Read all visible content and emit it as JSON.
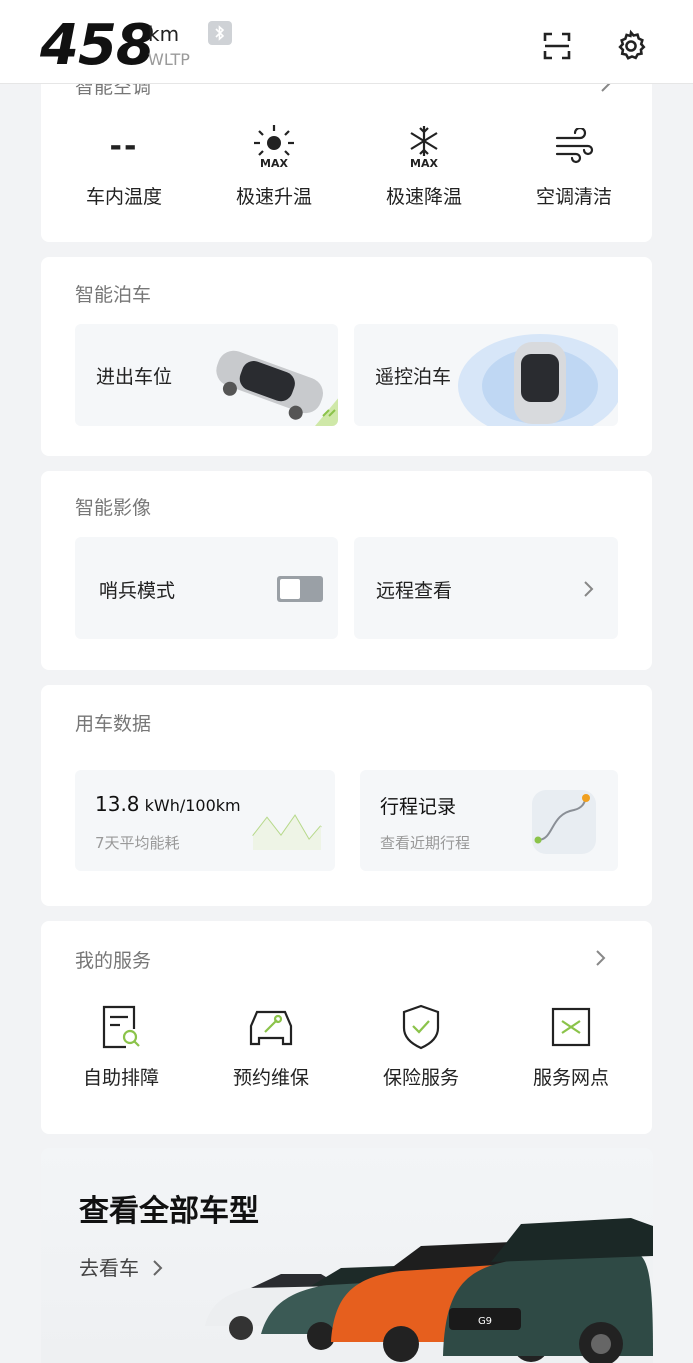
{
  "header": {
    "range_value": "458",
    "range_unit": "km",
    "range_standard": "WLTP"
  },
  "climate": {
    "title": "智能空调",
    "items": [
      {
        "label": "车内温度",
        "value": "--"
      },
      {
        "label": "极速升温",
        "badge": "MAX"
      },
      {
        "label": "极速降温",
        "badge": "MAX"
      },
      {
        "label": "空调清洁"
      }
    ]
  },
  "parking": {
    "title": "智能泊车",
    "items": [
      {
        "label": "进出车位"
      },
      {
        "label": "遥控泊车"
      }
    ]
  },
  "imaging": {
    "title": "智能影像",
    "sentry_label": "哨兵模式",
    "sentry_on": false,
    "remote_label": "远程查看"
  },
  "usage": {
    "title": "用车数据",
    "energy_value": "13.8",
    "energy_unit": "kWh/100km",
    "energy_caption": "7天平均能耗",
    "trip_title": "行程记录",
    "trip_caption": "查看近期行程"
  },
  "services": {
    "title": "我的服务",
    "items": [
      {
        "label": "自助排障"
      },
      {
        "label": "预约维保"
      },
      {
        "label": "保险服务"
      },
      {
        "label": "服务网点"
      }
    ]
  },
  "promo": {
    "title": "查看全部车型",
    "link": "去看车",
    "badges": [
      "G9"
    ]
  },
  "colors": {
    "accent_green": "#8bc34a",
    "orange": "#e65f1e",
    "teal": "#3b5a55"
  }
}
